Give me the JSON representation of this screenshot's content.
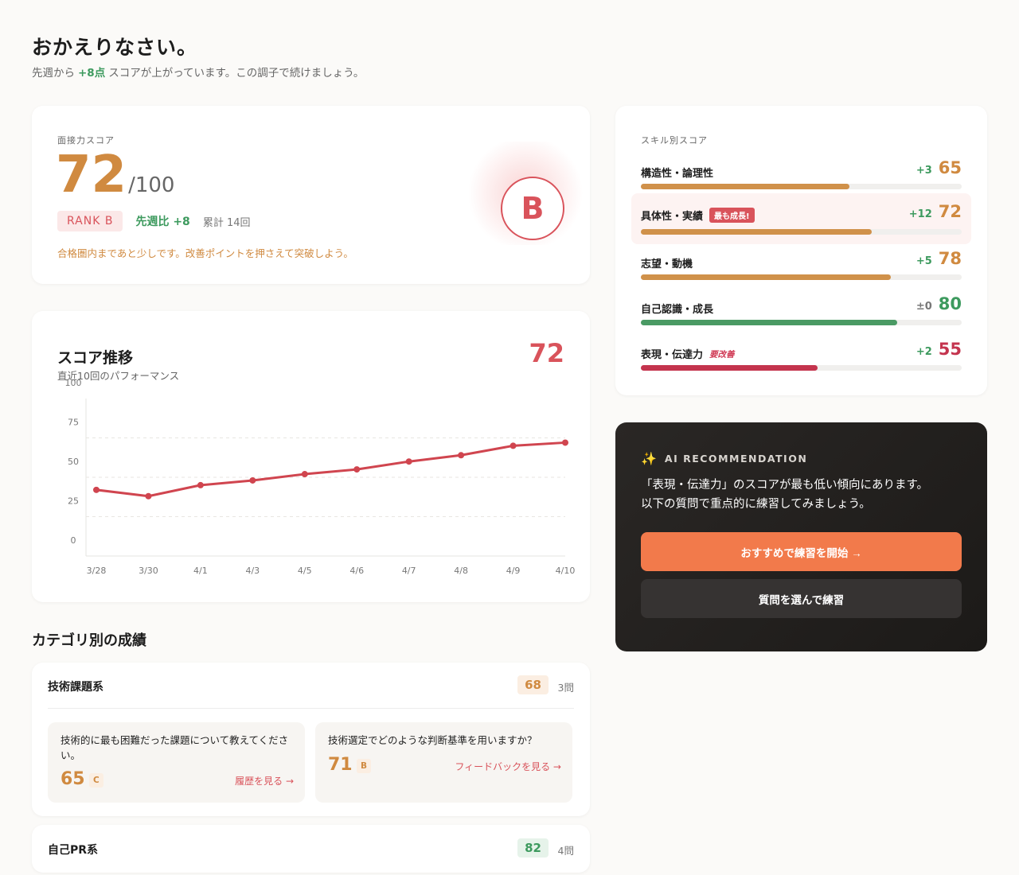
{
  "header": {
    "title": "おかえりなさい。",
    "subtitle_pre": "先週から",
    "subtitle_delta": "+8点",
    "subtitle_post": "スコアが上がっています。この調子で続けましょう。"
  },
  "score_card": {
    "label": "面接力スコア",
    "score": "72",
    "max": "/100",
    "rank": "RANK B",
    "weekly": "先週比 +8",
    "total": "累計 14回",
    "note": "合格圏内まであと少しです。改善ポイントを押さえて突破しよう。",
    "grade": "B"
  },
  "trend": {
    "title": "スコア推移",
    "subtitle": "直近10回のパフォーマンス",
    "latest": "72"
  },
  "chart_data": {
    "type": "line",
    "x": [
      "3/28",
      "3/30",
      "4/1",
      "4/3",
      "4/5",
      "4/6",
      "4/7",
      "4/8",
      "4/9",
      "4/10"
    ],
    "yticks": [
      "100",
      "75",
      "50",
      "25",
      "0"
    ],
    "ylim": [
      0,
      100
    ],
    "series": [
      {
        "values": [
          42,
          38,
          45,
          48,
          52,
          55,
          60,
          64,
          70,
          72
        ]
      }
    ],
    "color": "#d0454f",
    "grid": "dashed horizontal"
  },
  "categories": {
    "heading": "カテゴリ別の成績",
    "items": [
      {
        "name": "技術課題系",
        "score": "68",
        "count": "3問",
        "questions": [
          {
            "text": "技術的に最も困難だった課題について教えてください。",
            "score": "65",
            "grade": "C",
            "link": "履歴を見る →"
          },
          {
            "text": "技術選定でどのような判断基準を用いますか？",
            "score": "71",
            "grade": "B",
            "link": "フィードバックを見る →"
          }
        ]
      },
      {
        "name": "自己PR系",
        "score": "82",
        "count": "4問"
      }
    ]
  },
  "skills": {
    "label": "スキル別スコア",
    "items": [
      {
        "name": "構造性・論理性",
        "tag": "",
        "delta": "+3",
        "value": "65",
        "level": 0.65,
        "color": "#d0914a",
        "value_color": "#d08a40",
        "delta_color": "#3d9a5e"
      },
      {
        "name": "具体性・実績",
        "tag": "最も成長!",
        "delta": "+12",
        "value": "72",
        "level": 0.72,
        "color": "#d0914a",
        "value_color": "#d08a40",
        "delta_color": "#3d9a5e"
      },
      {
        "name": "志望・動機",
        "tag": "",
        "delta": "+5",
        "value": "78",
        "level": 0.78,
        "color": "#d0914a",
        "value_color": "#d08a40",
        "delta_color": "#3d9a5e"
      },
      {
        "name": "自己認識・成長",
        "tag": "",
        "delta": "±0",
        "value": "80",
        "level": 0.8,
        "color": "#4a9a64",
        "value_color": "#3d9a5e",
        "delta_color": "#777777"
      },
      {
        "name": "表現・伝達力",
        "tag": "要改善",
        "delta": "+2",
        "value": "55",
        "level": 0.55,
        "color": "#c4344e",
        "value_color": "#c4344e",
        "delta_color": "#3d9a5e"
      }
    ]
  },
  "ai": {
    "header": "AI RECOMMENDATION",
    "line1": "「表現・伝達力」のスコアが最も低い傾向にあります。",
    "line2": "以下の質問で重点的に練習してみましょう。",
    "primary_button": "おすすめで練習を開始 →",
    "secondary_button": "質問を選んで練習"
  }
}
